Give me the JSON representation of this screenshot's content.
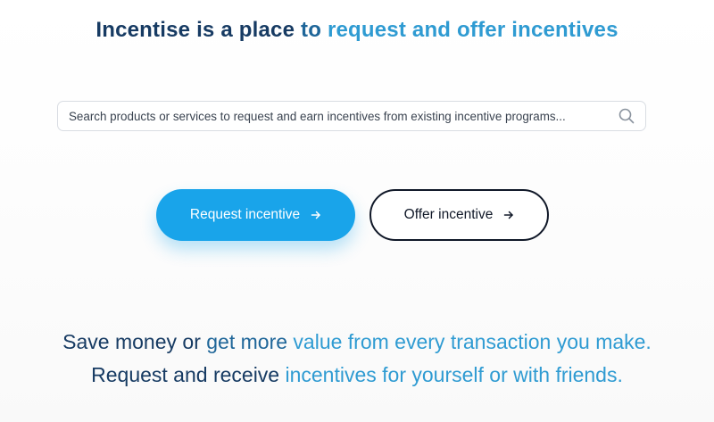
{
  "colors": {
    "navy": "#173b63",
    "mid_blue": "#1f6699",
    "light_blue": "#2f9bd2",
    "primary_button": "#19a4ea",
    "dark_text": "#101828"
  },
  "header": {
    "title_part1": "Incentise is a place",
    "title_part2": " to ",
    "title_part3": "request and offer incentives"
  },
  "search": {
    "placeholder": "Search products or services to request and earn incentives from existing incentive programs...",
    "value": "",
    "icon": "search-icon"
  },
  "actions": {
    "request_label": "Request incentive",
    "offer_label": "Offer incentive",
    "arrow_icon": "arrow-right-icon"
  },
  "tagline": {
    "line1_part1": "Save money or ",
    "line1_part2": "get more ",
    "line1_part3": "value from every transaction you make.",
    "line2_part1": "Request and receive ",
    "line2_part2": "incentives for yourself or with friends."
  }
}
